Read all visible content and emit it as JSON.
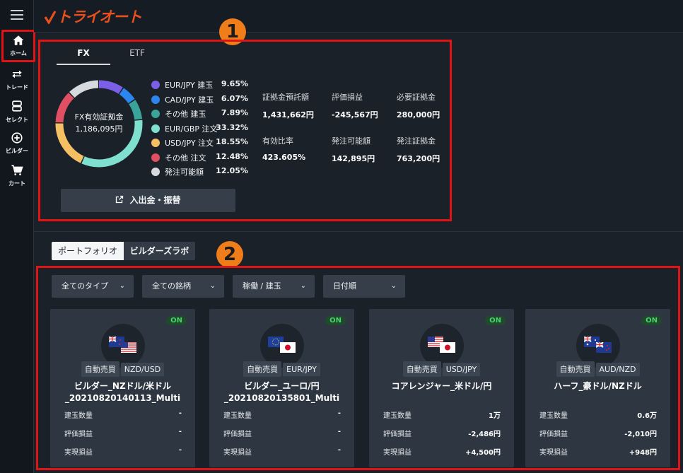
{
  "app": {
    "logo_text": "トライオート",
    "brand_color": "#e8501e"
  },
  "sidebar": {
    "menu_icon": "hamburger-icon",
    "items": [
      {
        "label": "ホーム",
        "icon": "home-icon"
      },
      {
        "label": "トレード",
        "icon": "trade-arrows-icon"
      },
      {
        "label": "セレクト",
        "icon": "select-icon"
      },
      {
        "label": "ビルダー",
        "icon": "plus-circle-icon"
      },
      {
        "label": "カート",
        "icon": "cart-icon"
      }
    ]
  },
  "badges": {
    "one": "1",
    "two": "2"
  },
  "summary": {
    "tabs": [
      {
        "label": "FX"
      },
      {
        "label": "ETF"
      }
    ],
    "active_tab": "FX",
    "donut_title": "FX有効証拠金",
    "donut_value": "1,186,095円",
    "legend": [
      {
        "name": "EUR/JPY 建玉",
        "pct": "9.65%",
        "color": "#7b5fe6"
      },
      {
        "name": "CAD/JPY 建玉",
        "pct": "6.07%",
        "color": "#2b86f0"
      },
      {
        "name": "その他 建玉",
        "pct": "7.89%",
        "color": "#3aa39a"
      },
      {
        "name": "EUR/GBP 注文",
        "pct": "33.32%",
        "color": "#7fe0cf"
      },
      {
        "name": "USD/JPY 注文",
        "pct": "18.55%",
        "color": "#f5c064"
      },
      {
        "name": "その他 注文",
        "pct": "12.48%",
        "color": "#e04f62"
      },
      {
        "name": "発注可能額",
        "pct": "12.05%",
        "color": "#d6d9dd"
      }
    ],
    "metrics": [
      {
        "label": "証拠金預託額",
        "value": "1,431,662円"
      },
      {
        "label": "評価損益",
        "value": "-245,567円"
      },
      {
        "label": "必要証拠金",
        "value": "280,000円"
      },
      {
        "label": "有効比率",
        "value": "423.605%"
      },
      {
        "label": "発注可能額",
        "value": "142,895円"
      },
      {
        "label": "発注証拠金",
        "value": "763,200円"
      }
    ],
    "deposit_button": "入出金・振替"
  },
  "portfolio": {
    "tabs": [
      {
        "label": "ポートフォリオ"
      },
      {
        "label": "ビルダーズラボ"
      }
    ],
    "filters": [
      {
        "label": "全てのタイプ"
      },
      {
        "label": "全ての銘柄"
      },
      {
        "label": "稼働 / 建玉"
      },
      {
        "label": "日付順"
      }
    ],
    "stat_labels": {
      "position": "建玉数量",
      "unrealized": "評価損益",
      "realized": "実現損益"
    },
    "cards": [
      {
        "status": "ON",
        "type": "自動売買",
        "pair": "NZD/USD",
        "flags": [
          "new-zealand-flag",
          "us-flag"
        ],
        "title_line1": "ビルダー_NZドル/米ドル",
        "title_line2": "_20210820140113_Multi",
        "position": "-",
        "unrealized": "-",
        "realized": "-"
      },
      {
        "status": "ON",
        "type": "自動売買",
        "pair": "EUR/JPY",
        "flags": [
          "eu-flag",
          "japan-flag"
        ],
        "title_line1": "ビルダー_ユーロ/円",
        "title_line2": "_20210820135801_Multi",
        "position": "-",
        "unrealized": "-",
        "realized": "-"
      },
      {
        "status": "ON",
        "type": "自動売買",
        "pair": "USD/JPY",
        "flags": [
          "us-flag",
          "japan-flag"
        ],
        "title_line1": "コアレンジャー_米ドル/円",
        "title_line2": "",
        "position": "1万",
        "unrealized": "-2,486円",
        "realized": "+4,500円"
      },
      {
        "status": "ON",
        "type": "自動売買",
        "pair": "AUD/NZD",
        "flags": [
          "australia-flag",
          "new-zealand-flag"
        ],
        "title_line1": "ハーフ_豪ドル/NZドル",
        "title_line2": "",
        "position": "0.6万",
        "unrealized": "-2,010円",
        "realized": "+948円"
      }
    ]
  }
}
